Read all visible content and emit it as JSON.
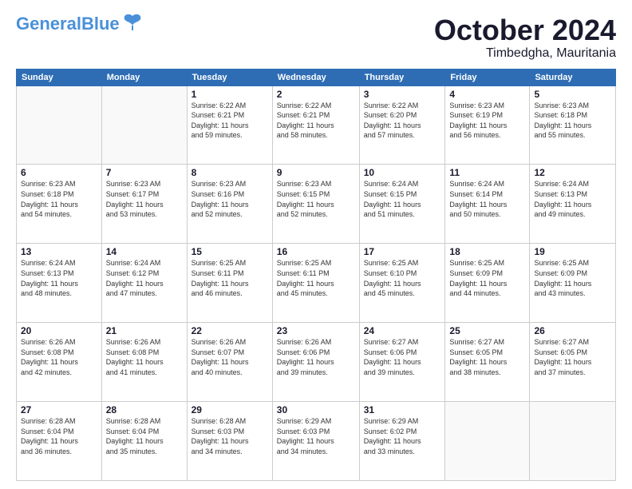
{
  "header": {
    "logo_line1": "General",
    "logo_line2": "Blue",
    "month": "October 2024",
    "location": "Timbedgha, Mauritania"
  },
  "days_of_week": [
    "Sunday",
    "Monday",
    "Tuesday",
    "Wednesday",
    "Thursday",
    "Friday",
    "Saturday"
  ],
  "weeks": [
    [
      {
        "day": "",
        "info": ""
      },
      {
        "day": "",
        "info": ""
      },
      {
        "day": "1",
        "info": "Sunrise: 6:22 AM\nSunset: 6:21 PM\nDaylight: 11 hours\nand 59 minutes."
      },
      {
        "day": "2",
        "info": "Sunrise: 6:22 AM\nSunset: 6:21 PM\nDaylight: 11 hours\nand 58 minutes."
      },
      {
        "day": "3",
        "info": "Sunrise: 6:22 AM\nSunset: 6:20 PM\nDaylight: 11 hours\nand 57 minutes."
      },
      {
        "day": "4",
        "info": "Sunrise: 6:23 AM\nSunset: 6:19 PM\nDaylight: 11 hours\nand 56 minutes."
      },
      {
        "day": "5",
        "info": "Sunrise: 6:23 AM\nSunset: 6:18 PM\nDaylight: 11 hours\nand 55 minutes."
      }
    ],
    [
      {
        "day": "6",
        "info": "Sunrise: 6:23 AM\nSunset: 6:18 PM\nDaylight: 11 hours\nand 54 minutes."
      },
      {
        "day": "7",
        "info": "Sunrise: 6:23 AM\nSunset: 6:17 PM\nDaylight: 11 hours\nand 53 minutes."
      },
      {
        "day": "8",
        "info": "Sunrise: 6:23 AM\nSunset: 6:16 PM\nDaylight: 11 hours\nand 52 minutes."
      },
      {
        "day": "9",
        "info": "Sunrise: 6:23 AM\nSunset: 6:15 PM\nDaylight: 11 hours\nand 52 minutes."
      },
      {
        "day": "10",
        "info": "Sunrise: 6:24 AM\nSunset: 6:15 PM\nDaylight: 11 hours\nand 51 minutes."
      },
      {
        "day": "11",
        "info": "Sunrise: 6:24 AM\nSunset: 6:14 PM\nDaylight: 11 hours\nand 50 minutes."
      },
      {
        "day": "12",
        "info": "Sunrise: 6:24 AM\nSunset: 6:13 PM\nDaylight: 11 hours\nand 49 minutes."
      }
    ],
    [
      {
        "day": "13",
        "info": "Sunrise: 6:24 AM\nSunset: 6:13 PM\nDaylight: 11 hours\nand 48 minutes."
      },
      {
        "day": "14",
        "info": "Sunrise: 6:24 AM\nSunset: 6:12 PM\nDaylight: 11 hours\nand 47 minutes."
      },
      {
        "day": "15",
        "info": "Sunrise: 6:25 AM\nSunset: 6:11 PM\nDaylight: 11 hours\nand 46 minutes."
      },
      {
        "day": "16",
        "info": "Sunrise: 6:25 AM\nSunset: 6:11 PM\nDaylight: 11 hours\nand 45 minutes."
      },
      {
        "day": "17",
        "info": "Sunrise: 6:25 AM\nSunset: 6:10 PM\nDaylight: 11 hours\nand 45 minutes."
      },
      {
        "day": "18",
        "info": "Sunrise: 6:25 AM\nSunset: 6:09 PM\nDaylight: 11 hours\nand 44 minutes."
      },
      {
        "day": "19",
        "info": "Sunrise: 6:25 AM\nSunset: 6:09 PM\nDaylight: 11 hours\nand 43 minutes."
      }
    ],
    [
      {
        "day": "20",
        "info": "Sunrise: 6:26 AM\nSunset: 6:08 PM\nDaylight: 11 hours\nand 42 minutes."
      },
      {
        "day": "21",
        "info": "Sunrise: 6:26 AM\nSunset: 6:08 PM\nDaylight: 11 hours\nand 41 minutes."
      },
      {
        "day": "22",
        "info": "Sunrise: 6:26 AM\nSunset: 6:07 PM\nDaylight: 11 hours\nand 40 minutes."
      },
      {
        "day": "23",
        "info": "Sunrise: 6:26 AM\nSunset: 6:06 PM\nDaylight: 11 hours\nand 39 minutes."
      },
      {
        "day": "24",
        "info": "Sunrise: 6:27 AM\nSunset: 6:06 PM\nDaylight: 11 hours\nand 39 minutes."
      },
      {
        "day": "25",
        "info": "Sunrise: 6:27 AM\nSunset: 6:05 PM\nDaylight: 11 hours\nand 38 minutes."
      },
      {
        "day": "26",
        "info": "Sunrise: 6:27 AM\nSunset: 6:05 PM\nDaylight: 11 hours\nand 37 minutes."
      }
    ],
    [
      {
        "day": "27",
        "info": "Sunrise: 6:28 AM\nSunset: 6:04 PM\nDaylight: 11 hours\nand 36 minutes."
      },
      {
        "day": "28",
        "info": "Sunrise: 6:28 AM\nSunset: 6:04 PM\nDaylight: 11 hours\nand 35 minutes."
      },
      {
        "day": "29",
        "info": "Sunrise: 6:28 AM\nSunset: 6:03 PM\nDaylight: 11 hours\nand 34 minutes."
      },
      {
        "day": "30",
        "info": "Sunrise: 6:29 AM\nSunset: 6:03 PM\nDaylight: 11 hours\nand 34 minutes."
      },
      {
        "day": "31",
        "info": "Sunrise: 6:29 AM\nSunset: 6:02 PM\nDaylight: 11 hours\nand 33 minutes."
      },
      {
        "day": "",
        "info": ""
      },
      {
        "day": "",
        "info": ""
      }
    ]
  ]
}
